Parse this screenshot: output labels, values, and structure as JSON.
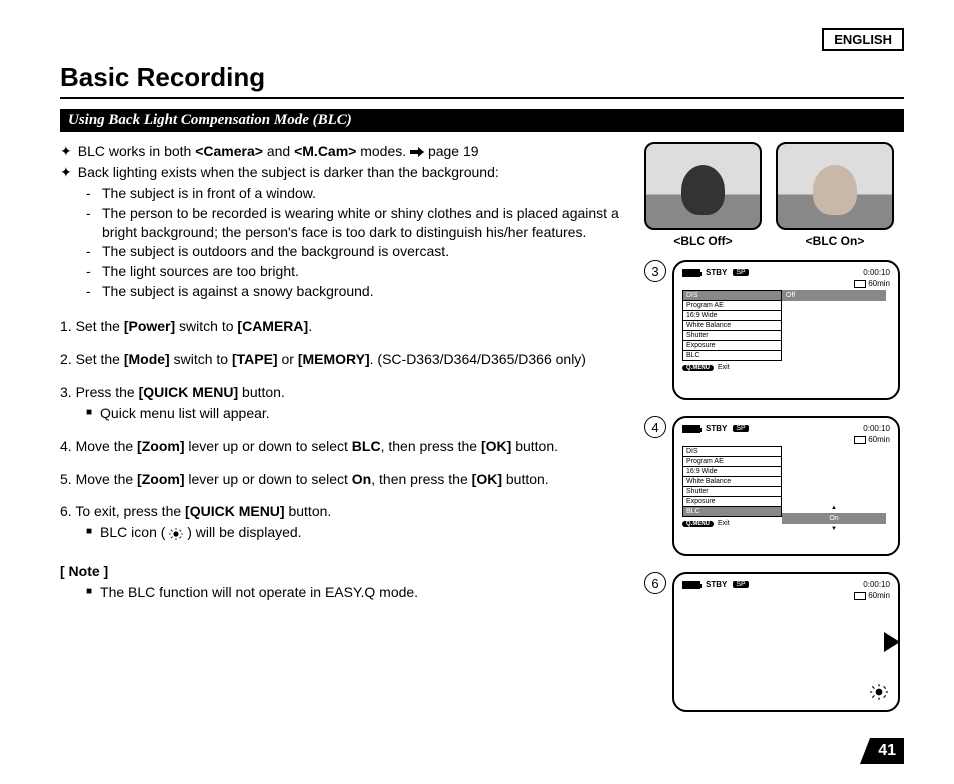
{
  "language_label": "ENGLISH",
  "page_title": "Basic Recording",
  "section_header": "Using Back Light Compensation Mode (BLC)",
  "intro": {
    "line1_pre": "BLC works in both ",
    "line1_b1": "<Camera>",
    "line1_mid": " and ",
    "line1_b2": "<M.Cam>",
    "line1_post": " modes. ",
    "line1_ref": "page 19",
    "line2": "Back lighting exists when the subject is darker than the background:",
    "dashes": [
      "The subject is in front of a window.",
      "The person to be recorded is wearing white or shiny clothes and is placed against a bright background; the person's face is too dark to distinguish his/her features.",
      "The subject is outdoors and the background is overcast.",
      "The light sources are too bright.",
      "The subject is against a snowy background."
    ]
  },
  "steps": {
    "s1_pre": "1. Set the ",
    "s1_b1": "[Power]",
    "s1_mid": " switch to ",
    "s1_b2": "[CAMERA]",
    "s1_post": ".",
    "s2_pre": "2. Set the ",
    "s2_b1": "[Mode]",
    "s2_mid": " switch to ",
    "s2_b2": "[TAPE]",
    "s2_mid2": " or ",
    "s2_b3": "[MEMORY]",
    "s2_post": ". (SC-D363/D364/D365/D366 only)",
    "s3_pre": "3. Press the ",
    "s3_b1": "[QUICK MENU]",
    "s3_post": " button.",
    "s3_sub": "Quick menu list will appear.",
    "s4_pre": "4. Move the ",
    "s4_b1": "[Zoom]",
    "s4_mid": " lever up or down to select ",
    "s4_b2": "BLC",
    "s4_mid2": ", then press the ",
    "s4_b3": "[OK]",
    "s4_post": " button.",
    "s5_pre": "5. Move the ",
    "s5_b1": "[Zoom]",
    "s5_mid": " lever up or down to select ",
    "s5_b2": "On",
    "s5_mid2": ", then press the ",
    "s5_b3": "[OK]",
    "s5_post": " button.",
    "s6_pre": "6. To exit, press the ",
    "s6_b1": "[QUICK MENU]",
    "s6_post": " button.",
    "s6_sub_pre": "BLC icon (",
    "s6_sub_post": ") will be displayed."
  },
  "note": {
    "header": "[ Note ]",
    "text": "The BLC function will not operate in EASY.Q mode."
  },
  "figures": {
    "caption_off": "<BLC Off>",
    "caption_on": "<BLC On>",
    "screen_common": {
      "stby": "STBY",
      "sp": "SP",
      "timecode": "0:00:10",
      "remaining": "60min",
      "qmenu": "Q.MENU",
      "exit": "Exit"
    },
    "menu_items": [
      "DIS",
      "Program AE",
      "16:9 Wide",
      "White Balance",
      "Shutter",
      "Exposure",
      "BLC"
    ],
    "screen3_hl_value": "Off",
    "screen4_hl_value": "On",
    "step_labels": {
      "a": "3",
      "b": "4",
      "c": "6"
    }
  },
  "page_number": "41"
}
